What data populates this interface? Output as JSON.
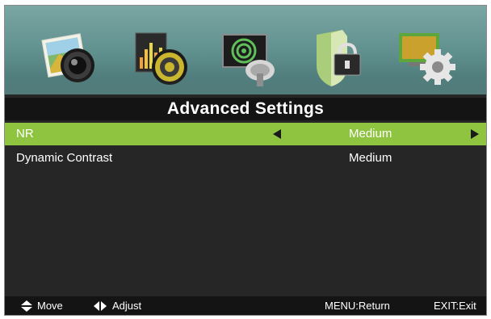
{
  "menu_icons": [
    "picture-icon",
    "sound-icon",
    "channel-icon",
    "lock-icon",
    "setup-icon"
  ],
  "title": "Advanced Settings",
  "rows": [
    {
      "label": "NR",
      "value": "Medium",
      "selected": true
    },
    {
      "label": "Dynamic Contrast",
      "value": "Medium",
      "selected": false
    }
  ],
  "help": {
    "move": "Move",
    "adjust": "Adjust",
    "menu": "MENU:Return",
    "exit": "EXIT:Exit"
  },
  "colors": {
    "highlight": "#8fc440",
    "background": "#262626",
    "icon_bar": "#5f8f8d"
  }
}
